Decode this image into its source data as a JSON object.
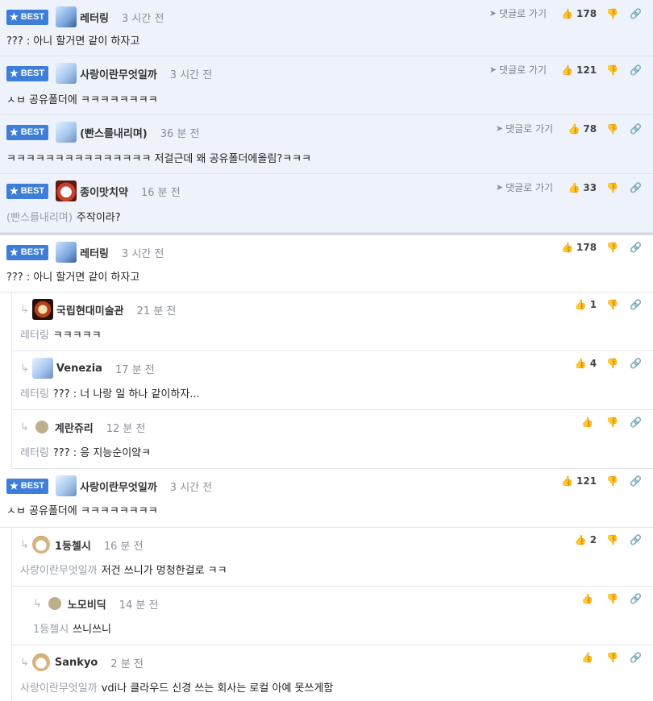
{
  "badge_label": "BEST",
  "reply_label": "댓글로 가기",
  "best": [
    {
      "nick": "레터링",
      "time": "3 시간 전",
      "likes": "178",
      "text": "??? : 아니 할거면 같이 하자고",
      "mention": ""
    },
    {
      "nick": "사랑이란무엇일까",
      "time": "3 시간 전",
      "likes": "121",
      "text": "ㅅㅂ 공유폴더에 ㅋㅋㅋㅋㅋㅋㅋㅋ",
      "mention": ""
    },
    {
      "nick": "(빤스를내리며)",
      "time": "36 분 전",
      "likes": "78",
      "text": "ㅋㅋㅋㅋㅋㅋㅋㅋㅋㅋㅋㅋㅋㅋㅋ 저걸근데 왜 공유폴더에올림?ㅋㅋㅋ",
      "mention": ""
    },
    {
      "nick": "종이맛치약",
      "time": "16 분 전",
      "likes": "33",
      "text": "주작이라?",
      "mention": "(빤스를내리며)"
    }
  ],
  "thread1": {
    "root": {
      "nick": "레터링",
      "time": "3 시간 전",
      "likes": "178",
      "text": "??? : 아니 할거면 같이 하자고"
    },
    "replies": [
      {
        "nick": "국립현대미술관",
        "time": "21 분 전",
        "likes": "1",
        "mention": "레터링",
        "text": "ㅋㅋㅋㅋㅋ"
      },
      {
        "nick": "Venezia",
        "time": "17 분 전",
        "likes": "4",
        "mention": "레터링",
        "text": "??? : 너 나랑 일 하나 같이하자..."
      },
      {
        "nick": "계란쥬리",
        "time": "12 분 전",
        "likes": "",
        "mention": "레터링",
        "text": "??? : 응 지능순이얔ㅋ"
      }
    ]
  },
  "thread2": {
    "root": {
      "nick": "사랑이란무엇일까",
      "time": "3 시간 전",
      "likes": "121",
      "text": "ㅅㅂ 공유폴더에 ㅋㅋㅋㅋㅋㅋㅋㅋ"
    },
    "replies": [
      {
        "nick": "1등첼시",
        "time": "16 분 전",
        "likes": "2",
        "mention": "사랑이란무엇일까",
        "text": "저건 쓰니가 멍청한걸로 ㅋㅋ"
      },
      {
        "nick": "노모비딕",
        "time": "14 분 전",
        "likes": "",
        "mention": "1등첼시",
        "text": "쓰니쓰니"
      },
      {
        "nick": "Sankyo",
        "time": "2 분 전",
        "likes": "",
        "mention": "사랑이란무엇일까",
        "text": "vdi나 클라우드 신경 쓰는 회사는 로컬 아예 못쓰게함"
      }
    ]
  },
  "colors": {
    "badge": "#3e7ed8",
    "best_bg": "#eef2fa"
  },
  "icons": {
    "like": "thumbs-up-icon",
    "dislike": "thumbs-down-icon",
    "link": "link-icon",
    "reply": "reply-arrow-icon",
    "star": "star-icon"
  }
}
